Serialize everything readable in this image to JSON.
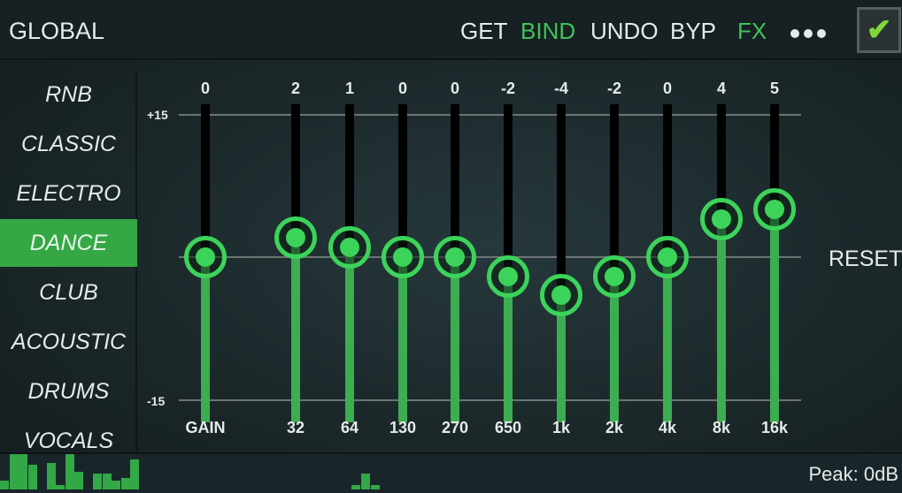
{
  "header": {
    "title": "GLOBAL",
    "buttons": [
      {
        "label": "GET",
        "color": "#e6eaea"
      },
      {
        "label": "BIND",
        "color": "#3fc35a"
      },
      {
        "label": "UNDO",
        "color": "#e6eaea"
      },
      {
        "label": "BYP",
        "color": "#e6eaea"
      },
      {
        "label": "FX",
        "color": "#3fc35a"
      }
    ],
    "more_icon": "more-dots-icon",
    "confirm_icon": "checkmark-icon"
  },
  "presets": {
    "items": [
      "RNB",
      "CLASSIC",
      "ELECTRO",
      "DANCE",
      "CLUB",
      "ACOUSTIC",
      "DRUMS",
      "VOCALS"
    ],
    "selected": "DANCE"
  },
  "eq": {
    "scale_max": "+15",
    "scale_min": "-15",
    "range_db": [
      -15,
      15
    ],
    "bands": [
      {
        "label": "GAIN",
        "value": 0
      },
      {
        "label": "32",
        "value": 2
      },
      {
        "label": "64",
        "value": 1
      },
      {
        "label": "130",
        "value": 0
      },
      {
        "label": "270",
        "value": 0
      },
      {
        "label": "650",
        "value": -2
      },
      {
        "label": "1k",
        "value": -4
      },
      {
        "label": "2k",
        "value": -2
      },
      {
        "label": "4k",
        "value": 0
      },
      {
        "label": "8k",
        "value": 4
      },
      {
        "label": "16k",
        "value": 5
      }
    ],
    "reset_label": "RESET",
    "accent": "#3cd35a"
  },
  "spectrum": {
    "left_levels": [
      0.22,
      0.89,
      0.89,
      0.62,
      0,
      0.67,
      0.11,
      0.89,
      0.44,
      0,
      0.4,
      0.4,
      0.22,
      0.29,
      0.76
    ],
    "right_levels": [
      0.11,
      0.4,
      0.11
    ],
    "peak": "Peak: 0dB"
  }
}
